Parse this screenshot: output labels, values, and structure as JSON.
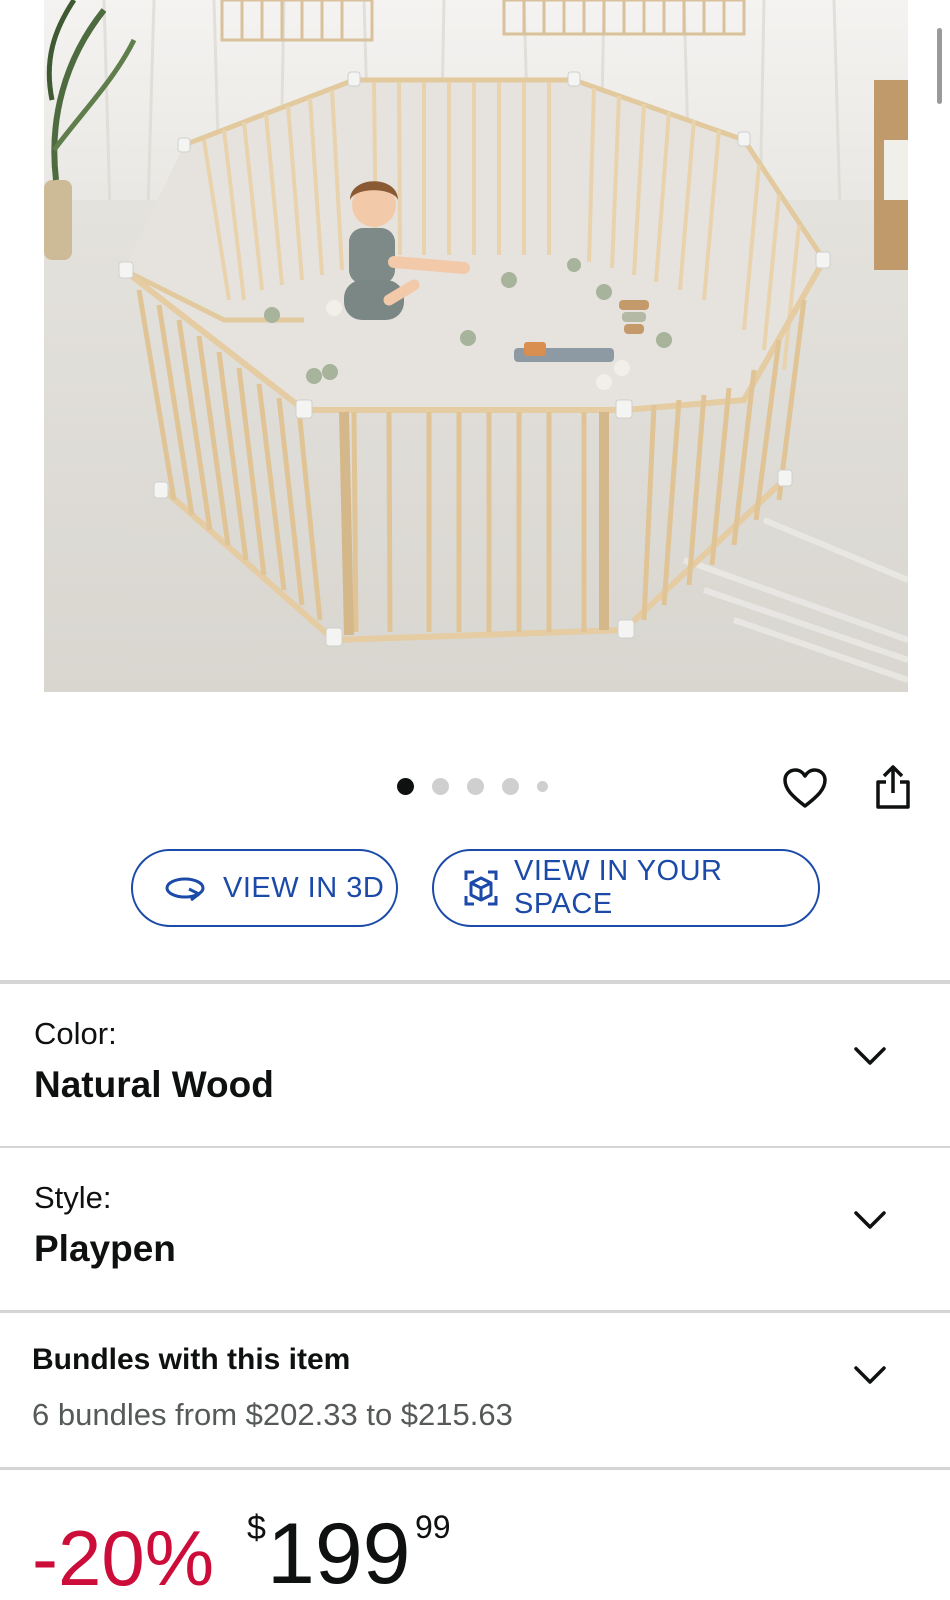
{
  "image": {
    "alt_semantic": "product-photo",
    "carousel": {
      "count": 5,
      "active": 1
    }
  },
  "actions": {
    "view_3d_label": "VIEW IN 3D",
    "view_space_label": "VIEW IN YOUR SPACE"
  },
  "options": {
    "color": {
      "label": "Color:",
      "value": "Natural Wood"
    },
    "style": {
      "label": "Style:",
      "value": "Playpen"
    }
  },
  "bundles": {
    "title": "Bundles with this item",
    "subtitle": "6 bundles from $202.33 to $215.63"
  },
  "price": {
    "discount": "-20%",
    "currency": "$",
    "whole": "199",
    "fraction": "99"
  },
  "colors": {
    "accent_blue": "#1b4aa8",
    "discount_red": "#cc0c39",
    "divider": "#d5d5d5"
  }
}
